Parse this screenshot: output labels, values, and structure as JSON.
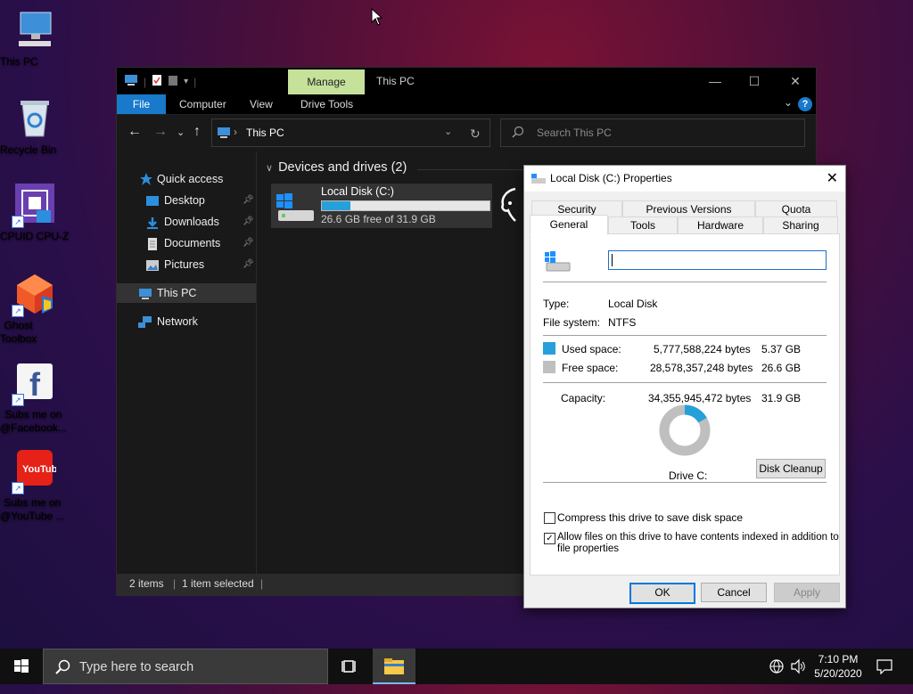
{
  "desktop": {
    "icons": [
      {
        "label": "This PC",
        "icon": "this-pc-icon"
      },
      {
        "label": "Recycle Bin",
        "icon": "recycle-bin-icon"
      },
      {
        "label": "CPUID CPU-Z",
        "icon": "cpuz-icon"
      },
      {
        "label": "Ghost\nToolbox",
        "icon": "ghost-toolbox-icon"
      },
      {
        "label": "Subs me on\n@Facebook...",
        "icon": "facebook-icon"
      },
      {
        "label": "Subs me on\n@YouTube ...",
        "icon": "youtube-icon"
      }
    ]
  },
  "explorer": {
    "title": "This PC",
    "contextual_tab": "Manage",
    "ribbon_tabs": [
      "File",
      "Computer",
      "View",
      "Drive Tools"
    ],
    "address": "This PC",
    "search_placeholder": "Search This PC",
    "nav": {
      "quick_access": "Quick access",
      "items": [
        {
          "label": "Desktop",
          "pinned": true
        },
        {
          "label": "Downloads",
          "pinned": true
        },
        {
          "label": "Documents",
          "pinned": true
        },
        {
          "label": "Pictures",
          "pinned": true
        }
      ],
      "this_pc": "This PC",
      "network": "Network"
    },
    "group_header": "Devices and drives (2)",
    "drive": {
      "name": "Local Disk (C:)",
      "free_text": "26.6 GB free of 31.9 GB",
      "used_fraction": 0.168
    },
    "status": {
      "items": "2 items",
      "selected": "1 item selected"
    }
  },
  "properties": {
    "title": "Local Disk (C:) Properties",
    "tabs_row1": [
      "Security",
      "Previous Versions",
      "Quota"
    ],
    "tabs_row2": [
      "General",
      "Tools",
      "Hardware",
      "Sharing"
    ],
    "active_tab": "General",
    "name_value": "",
    "type_label": "Type:",
    "type_value": "Local Disk",
    "fs_label": "File system:",
    "fs_value": "NTFS",
    "used_label": "Used space:",
    "used_bytes": "5,777,588,224 bytes",
    "used_gb": "5.37 GB",
    "free_label": "Free space:",
    "free_bytes": "28,578,357,248 bytes",
    "free_gb": "26.6 GB",
    "capacity_label": "Capacity:",
    "capacity_bytes": "34,355,945,472 bytes",
    "capacity_gb": "31.9 GB",
    "drive_label": "Drive C:",
    "cleanup_button": "Disk Cleanup",
    "compress_label": "Compress this drive to save disk space",
    "compress_checked": false,
    "index_label_line1": "Allow files on this drive to have contents indexed in addition to",
    "index_label_line2": "file properties",
    "index_checked": true,
    "ok": "OK",
    "cancel": "Cancel",
    "apply": "Apply",
    "used_color": "#26a0da",
    "free_color": "#bfbfbf"
  },
  "taskbar": {
    "search_placeholder": "Type here to search",
    "time": "7:10 PM",
    "date": "5/20/2020"
  }
}
